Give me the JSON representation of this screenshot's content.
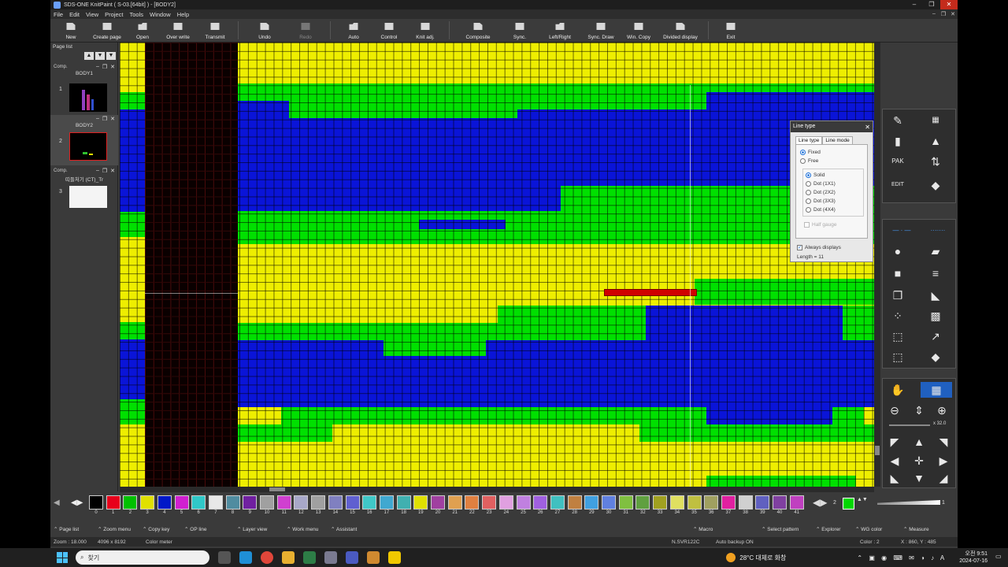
{
  "window": {
    "title": "SDS-ONE KnitPaint ( S-03.[64bit] ) - [BODY2]",
    "minimize": "–",
    "maximize": "❐",
    "close": "✕"
  },
  "menu": [
    "File",
    "Edit",
    "View",
    "Project",
    "Tools",
    "Window",
    "Help"
  ],
  "toolbar": [
    {
      "label": "New",
      "enabled": true
    },
    {
      "label": "Create page",
      "enabled": true
    },
    {
      "label": "Open",
      "enabled": true
    },
    {
      "label": "Over write",
      "enabled": true
    },
    {
      "label": "Transmit",
      "enabled": true
    },
    {
      "label": "Undo",
      "enabled": true
    },
    {
      "label": "Redo",
      "enabled": false
    },
    {
      "label": "Auto",
      "enabled": true
    },
    {
      "label": "Control",
      "enabled": true
    },
    {
      "label": "Knit adj.",
      "enabled": true
    },
    {
      "label": "Composite",
      "enabled": true
    },
    {
      "label": "Sync.",
      "enabled": true
    },
    {
      "label": "Left/Right",
      "enabled": true
    },
    {
      "label": "Sync. Draw",
      "enabled": true
    },
    {
      "label": "Win. Copy",
      "enabled": true
    },
    {
      "label": "Divided display",
      "enabled": true
    },
    {
      "label": "Exit",
      "enabled": true
    }
  ],
  "page_list": {
    "title": "Page list",
    "pages": [
      {
        "number": "1",
        "header": "Comp.",
        "name": "BODY1",
        "selected": false
      },
      {
        "number": "2",
        "header": "",
        "name": "BODY2",
        "selected": true
      },
      {
        "number": "3",
        "header": "Comp.",
        "name": "띠들처기 (CT)_Tr",
        "selected": false
      }
    ]
  },
  "line_type_dialog": {
    "title": "Line type",
    "tabs": [
      "Line type",
      "Line mode"
    ],
    "mode_options": [
      {
        "label": "Fixed",
        "selected": true
      },
      {
        "label": "Free",
        "selected": false
      }
    ],
    "style_options": [
      {
        "label": "Solid",
        "selected": true
      },
      {
        "label": "Dot (1X1)",
        "selected": false
      },
      {
        "label": "Dot (2X2)",
        "selected": false
      },
      {
        "label": "Dot (3X3)",
        "selected": false
      },
      {
        "label": "Dot (4X4)",
        "selected": false
      }
    ],
    "half_gauge": "Half gauge",
    "always_display": "Always displays",
    "length": "Length = 11"
  },
  "zoom_readout": "x 32.0",
  "palette": {
    "colors": [
      {
        "n": "0",
        "c": "#000000"
      },
      {
        "n": "1",
        "c": "#e8001b"
      },
      {
        "n": "2",
        "c": "#00c000"
      },
      {
        "n": "3",
        "c": "#e0e000"
      },
      {
        "n": "4",
        "c": "#0018c8"
      },
      {
        "n": "5",
        "c": "#d020d0"
      },
      {
        "n": "6",
        "c": "#30c8c8"
      },
      {
        "n": "7",
        "c": "#e8e8e8"
      },
      {
        "n": "8",
        "c": "#508ca0"
      },
      {
        "n": "9",
        "c": "#7020a0"
      },
      {
        "n": "10",
        "c": "#a0a0a0"
      },
      {
        "n": "11",
        "c": "#d040d0"
      },
      {
        "n": "12",
        "c": "#a8a8c8"
      },
      {
        "n": "13",
        "c": "#a0a0a0"
      },
      {
        "n": "14",
        "c": "#8080c0"
      },
      {
        "n": "15",
        "c": "#6060d0"
      },
      {
        "n": "16",
        "c": "#40c8c8"
      },
      {
        "n": "17",
        "c": "#40a8d0"
      },
      {
        "n": "18",
        "c": "#40b0b0"
      },
      {
        "n": "19",
        "c": "#e0e000"
      },
      {
        "n": "20",
        "c": "#a040a0"
      },
      {
        "n": "21",
        "c": "#e0a050"
      },
      {
        "n": "22",
        "c": "#e08040"
      },
      {
        "n": "23",
        "c": "#e06060"
      },
      {
        "n": "24",
        "c": "#e0a0e0"
      },
      {
        "n": "25",
        "c": "#c080e0"
      },
      {
        "n": "26",
        "c": "#a060e0"
      },
      {
        "n": "27",
        "c": "#40c0c0"
      },
      {
        "n": "28",
        "c": "#c08040"
      },
      {
        "n": "29",
        "c": "#40a0e0"
      },
      {
        "n": "30",
        "c": "#6080e0"
      },
      {
        "n": "31",
        "c": "#80c040"
      },
      {
        "n": "32",
        "c": "#60a040"
      },
      {
        "n": "33",
        "c": "#a0a020"
      },
      {
        "n": "34",
        "c": "#e0e060"
      },
      {
        "n": "35",
        "c": "#c0c040"
      },
      {
        "n": "36",
        "c": "#a0a060"
      },
      {
        "n": "37",
        "c": "#e020a0"
      },
      {
        "n": "38",
        "c": "#d0d0d0"
      },
      {
        "n": "39",
        "c": "#6060c0"
      },
      {
        "n": "40",
        "c": "#8040a0"
      },
      {
        "n": "41",
        "c": "#c040c0"
      }
    ],
    "current_index": "2",
    "current_color": "#00d800",
    "line_width": "1"
  },
  "bottom_tabs": [
    "Page list",
    "Zoom menu",
    "Copy key",
    "OP line",
    "Layer view",
    "Work menu",
    "Assistant",
    "Macro",
    "Select pattern",
    "Explorer",
    "WG color",
    "Measure"
  ],
  "status": {
    "zoom": "Zoom : 18.000",
    "size": "4096 x 8192",
    "color_meter": "Color meter",
    "code": "N.SVR122C",
    "backup": "Auto backup ON",
    "color": "Color : 2",
    "coords": "X : 860, Y : 485"
  },
  "taskbar": {
    "search": "찾기",
    "weather": "28°C  대체로 화창",
    "time": "오전 9:51",
    "date": "2024-07-16"
  },
  "colors": {
    "yellow": "#eeee00",
    "green": "#00e000",
    "blue": "#0a14d8",
    "dark": "#0a0000",
    "red": "#d00000"
  }
}
